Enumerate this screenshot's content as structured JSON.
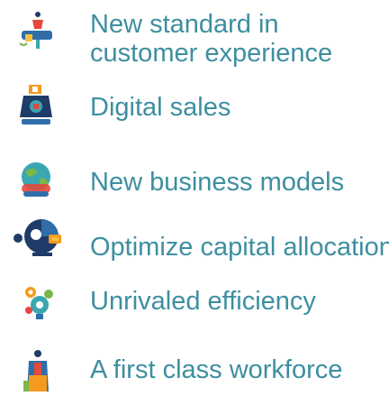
{
  "items": [
    {
      "label": "New standard in customer experience",
      "icon": "customer-experience-icon"
    },
    {
      "label": "Digital sales",
      "icon": "digital-sales-icon"
    },
    {
      "label": "New business models",
      "icon": "business-models-icon"
    },
    {
      "label": "Optimize capital allocation",
      "icon": "capital-allocation-icon"
    },
    {
      "label": "Unrivaled efficiency",
      "icon": "efficiency-gears-icon"
    },
    {
      "label": "A first class workforce",
      "icon": "workforce-icon"
    }
  ],
  "colors": {
    "text": "#3d8fa0",
    "navy": "#1f3c68",
    "blue": "#2f6ea9",
    "teal": "#3aa6b0",
    "red": "#e5483d",
    "orange": "#f39a1f",
    "yellow": "#f6c23e",
    "green": "#79b84a"
  }
}
